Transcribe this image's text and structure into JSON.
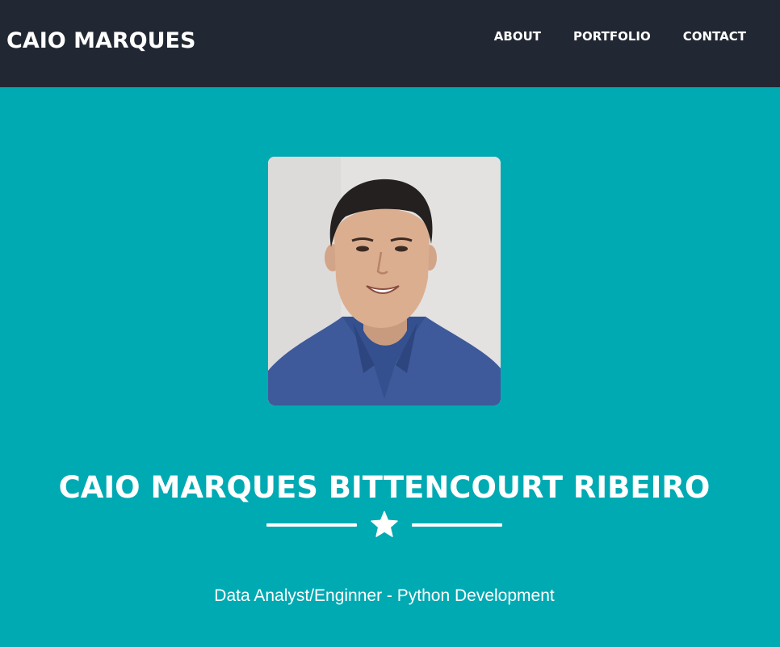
{
  "navbar": {
    "brand": "CAIO MARQUES",
    "links": [
      {
        "label": "ABOUT"
      },
      {
        "label": "PORTFOLIO"
      },
      {
        "label": "CONTACT"
      }
    ]
  },
  "masthead": {
    "photo_icon": "profile-photo",
    "heading": "CAIO MARQUES BITTENCOURT RIBEIRO",
    "divider_icon": "star-icon",
    "subheading": "Data Analyst/Enginner - Python Development"
  },
  "colors": {
    "navbar_bg": "#222833",
    "masthead_bg": "#00aab3",
    "text": "#ffffff"
  }
}
